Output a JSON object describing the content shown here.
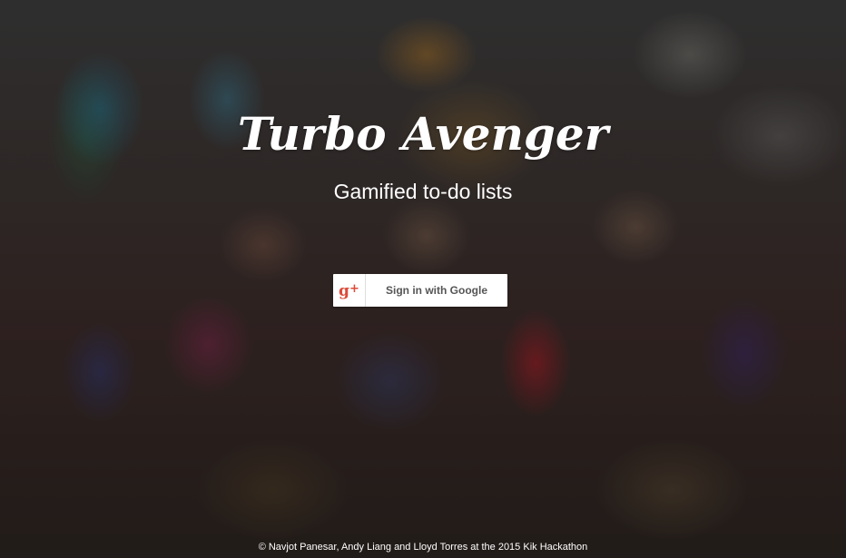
{
  "hero": {
    "title": "Turbo Avenger",
    "subtitle": "Gamified to-do lists"
  },
  "signin": {
    "label": "Sign in with Google",
    "icon": "google-plus-icon",
    "icon_color": "#dd4b39"
  },
  "footer": {
    "credit": "© Navjot Panesar, Andy Liang and Lloyd Torres at the 2015 Kik Hackathon"
  }
}
